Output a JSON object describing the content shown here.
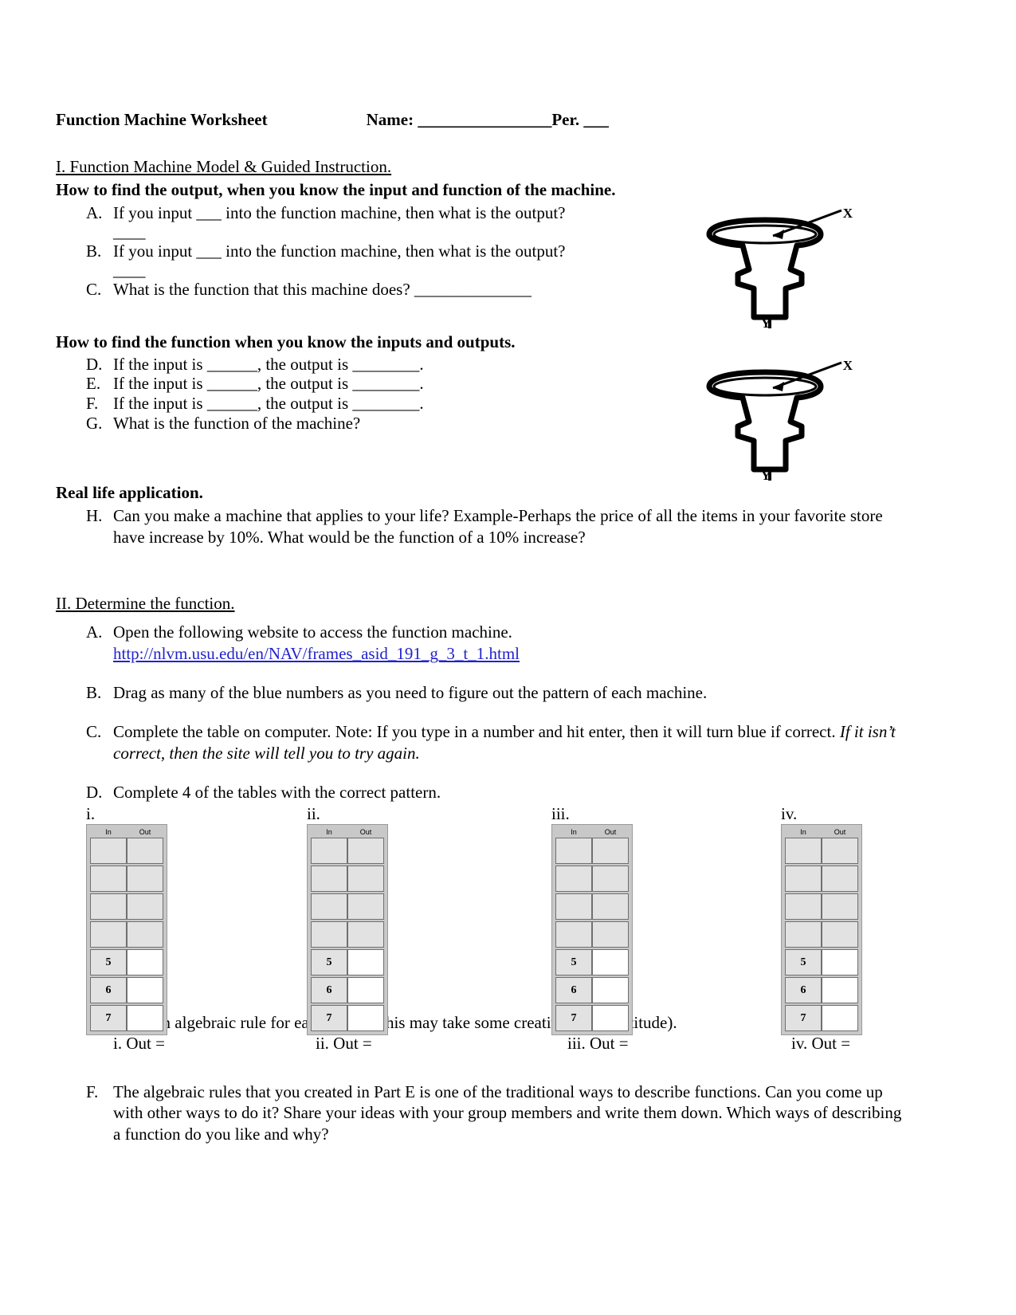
{
  "header": {
    "title": "Function Machine Worksheet",
    "name_field": "Name: ________________Per. ___"
  },
  "section_one": {
    "heading": "I. Function Machine Model & Guided Instruction.",
    "sub_heading_1": "How to find the output, when you know the input and function of the machine.",
    "items": [
      {
        "label": "A.",
        "text": "If you input ___ into the function machine, then what is the output?"
      },
      {
        "label": "B.",
        "text": "If you input ___ into the function machine, then what is the output?"
      },
      {
        "label": "C.",
        "text": "What is the function that this machine does?  ______________"
      }
    ],
    "answer_blank": "____",
    "sub_heading_2": "How to find the function when you know the inputs and outputs.",
    "items2": [
      {
        "label": "D.",
        "text": "If the input is ______, the output is ________."
      },
      {
        "label": "E.",
        "text": "If the input is ______, the output is ________."
      },
      {
        "label": "F.",
        "text": "If the input is ______, the output is ________."
      },
      {
        "label": "G.",
        "text": "What is the function of the machine?"
      }
    ],
    "real_life_heading": "Real life application.",
    "item_h": {
      "label": "H.",
      "text": "Can you make a machine that applies to your life?  Example-Perhaps the price of all the items in your favorite store have increase by 10%.  What would be the function of a 10% increase?"
    }
  },
  "machines": [
    {
      "input_label": "X",
      "output_label": "Y"
    },
    {
      "input_label": "X",
      "output_label": "Y"
    }
  ],
  "section_two": {
    "heading": "II. Determine the function.",
    "item_a": {
      "label": "A.",
      "text": "Open the following website to access the function machine."
    },
    "url": "http://nlvm.usu.edu/en/NAV/frames_asid_191_g_3_t_1.html",
    "item_b": {
      "label": "B.",
      "text": "Drag as many of the blue numbers as you need to figure out the pattern of each machine."
    },
    "item_c": {
      "label": "C.",
      "text_plain": "Complete the table on computer.  Note: If you type in a number and hit enter, then it will turn blue if correct.  ",
      "text_italic": "If it isn’t correct, then the site will tell you to try again."
    },
    "item_d": {
      "label": "D.",
      "text": "Complete 4 of the tables with the correct pattern."
    },
    "tables": [
      {
        "numeral": "i.",
        "col_in": "In",
        "col_out": "Out",
        "rows": [
          {
            "in": "",
            "out": "",
            "filled": false
          },
          {
            "in": "",
            "out": "",
            "filled": false
          },
          {
            "in": "",
            "out": "",
            "filled": false
          },
          {
            "in": "",
            "out": "",
            "filled": false
          },
          {
            "in": "5",
            "out": "",
            "filled": true
          },
          {
            "in": "6",
            "out": "",
            "filled": true
          },
          {
            "in": "7",
            "out": "",
            "filled": true
          }
        ]
      },
      {
        "numeral": "ii.",
        "col_in": "In",
        "col_out": "Out",
        "rows": [
          {
            "in": "",
            "out": "",
            "filled": false
          },
          {
            "in": "",
            "out": "",
            "filled": false
          },
          {
            "in": "",
            "out": "",
            "filled": false
          },
          {
            "in": "",
            "out": "",
            "filled": false
          },
          {
            "in": "5",
            "out": "",
            "filled": true
          },
          {
            "in": "6",
            "out": "",
            "filled": true
          },
          {
            "in": "7",
            "out": "",
            "filled": true
          }
        ]
      },
      {
        "numeral": "iii.",
        "col_in": "In",
        "col_out": "Out",
        "rows": [
          {
            "in": "",
            "out": "",
            "filled": false
          },
          {
            "in": "",
            "out": "",
            "filled": false
          },
          {
            "in": "",
            "out": "",
            "filled": false
          },
          {
            "in": "",
            "out": "",
            "filled": false
          },
          {
            "in": "5",
            "out": "",
            "filled": true
          },
          {
            "in": "6",
            "out": "",
            "filled": true
          },
          {
            "in": "7",
            "out": "",
            "filled": true
          }
        ]
      },
      {
        "numeral": "iv.",
        "col_in": "In",
        "col_out": "Out",
        "rows": [
          {
            "in": "",
            "out": "",
            "filled": false
          },
          {
            "in": "",
            "out": "",
            "filled": false
          },
          {
            "in": "",
            "out": "",
            "filled": false
          },
          {
            "in": "",
            "out": "",
            "filled": false
          },
          {
            "in": "5",
            "out": "",
            "filled": true
          },
          {
            "in": "6",
            "out": "",
            "filled": true
          },
          {
            "in": "7",
            "out": "",
            "filled": true
          }
        ]
      }
    ],
    "item_e": {
      "label": "E.",
      "text": "Write an algebraic rule for each table. (This may take some creativity and fortitude)."
    },
    "out_labels": [
      "i.  Out =",
      "ii. Out =",
      "iii. Out =",
      "iv. Out ="
    ],
    "item_f": {
      "label": "F.",
      "text": "The algebraic rules that you created in Part E is one of the traditional ways to describe functions. Can you come up with other ways to do it? Share your ideas with your group members and write them down. Which ways of describing a function do you like and why?"
    }
  },
  "colors": {
    "link": "#2222cc",
    "table_frame": "#c8c8c8",
    "table_cell": "#e2e2e2",
    "table_cell_out": "#ffffff",
    "text": "#000000"
  }
}
